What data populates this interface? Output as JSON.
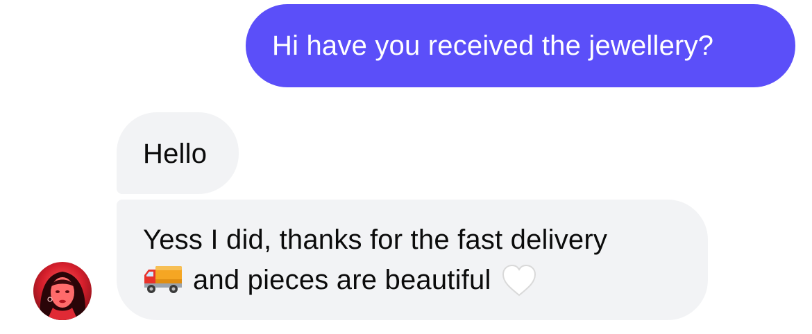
{
  "messages": {
    "outgoing_1": "Hi have you received the jewellery?",
    "incoming_1": "Hello",
    "incoming_2_line1": "Yess I did, thanks for the fast delivery",
    "incoming_2_line2": "and pieces are beautiful"
  },
  "icons": {
    "delivery": "delivery-truck-icon",
    "heart": "white-heart-icon",
    "avatar": "contact-avatar"
  },
  "colors": {
    "outgoing_bubble": "#5b4ff9",
    "incoming_bubble": "#f2f3f5",
    "outgoing_text": "#ffffff",
    "incoming_text": "#0b0b0b"
  }
}
